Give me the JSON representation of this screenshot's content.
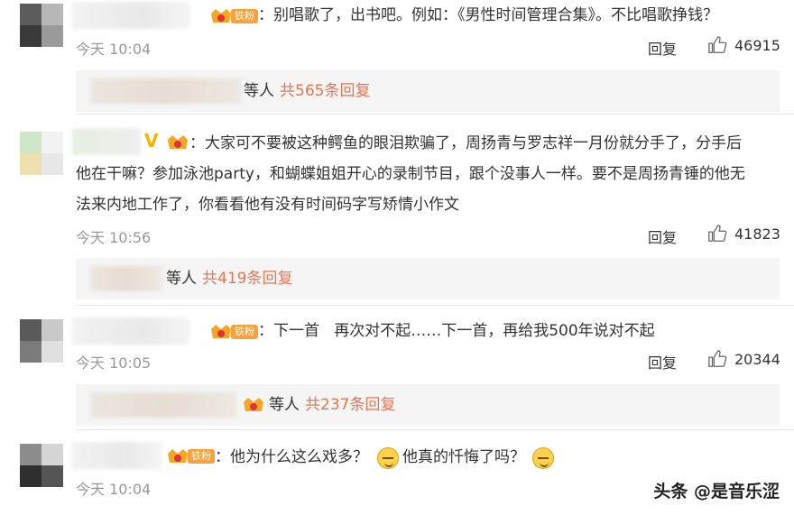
{
  "comments": [
    {
      "text": "：别唱歌了，出书吧。例如：《男性时间管理合集》。不比唱歌挣钱？",
      "badge": "铁粉",
      "time": "今天 10:04",
      "reply_label": "回复",
      "likes": "46915",
      "sub": {
        "prefix": "等人",
        "count": "共565条回复"
      }
    },
    {
      "text_lines": [
        "：大家可不要被这种鳄鱼的眼泪欺骗了，周扬青与罗志祥一月份就分手了，分手后",
        "他在干嘛？参加泳池party，和蝴蝶姐姐开心的录制节目，跟个没事人一样。要不是周扬青锤的他无",
        "法来内地工作了，你看看他有没有时间码字写矫情小作文"
      ],
      "v_mark": "V",
      "time": "今天 10:56",
      "reply_label": "回复",
      "likes": "41823",
      "sub": {
        "prefix": "等人",
        "count": "共419条回复"
      }
    },
    {
      "text": "：下一首   再次对不起……下一首，再给我500年说对不起",
      "badge": "铁粉",
      "time": "今天 10:05",
      "reply_label": "回复",
      "likes": "20344",
      "sub": {
        "prefix": "等人",
        "count": "共237条回复"
      }
    },
    {
      "text_a": "：他为什么这么戏多？",
      "text_b": "他真的忏悔了吗？",
      "badge": "铁粉",
      "time": "今天 10:04"
    }
  ],
  "watermark": "头条 @是音乐涩",
  "colors": {
    "accent": "#eb7350",
    "time": "#999999",
    "subbox": "#f5f5f5",
    "badge": "#f7a13c"
  },
  "icons": [
    "thumbs-up-icon",
    "crown-level-icon",
    "verified-v-icon",
    "smirk-emoji-icon"
  ]
}
